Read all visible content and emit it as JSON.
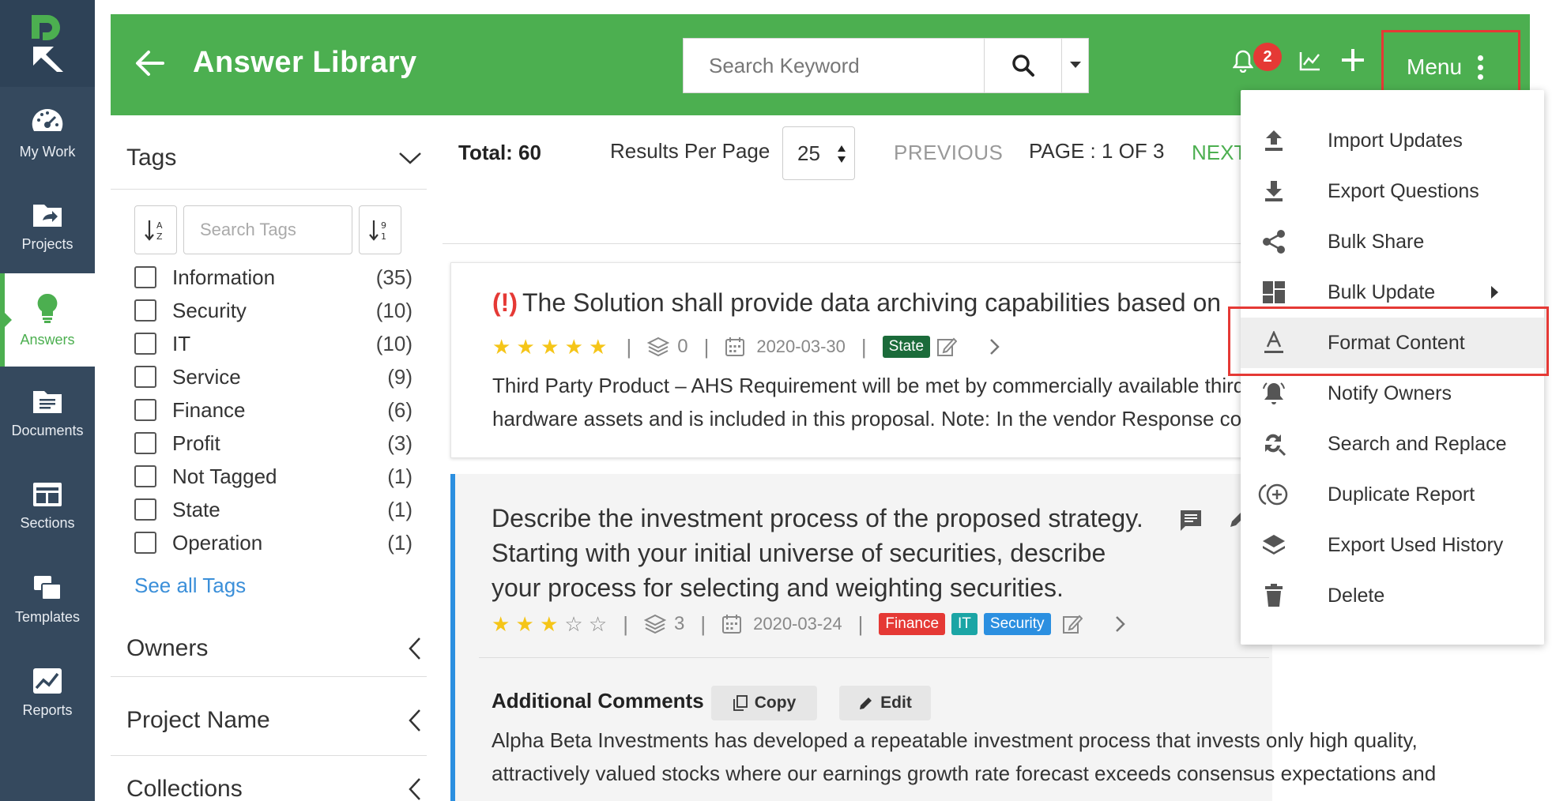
{
  "app": {
    "title": "Answer Library"
  },
  "nav": {
    "items": [
      {
        "label": "My Work",
        "icon": "speedometer-icon"
      },
      {
        "label": "Projects",
        "icon": "folder-share-icon"
      },
      {
        "label": "Answers",
        "icon": "lightbulb-icon",
        "active": true
      },
      {
        "label": "Documents",
        "icon": "document-icon"
      },
      {
        "label": "Sections",
        "icon": "sections-icon"
      },
      {
        "label": "Templates",
        "icon": "templates-icon"
      },
      {
        "label": "Reports",
        "icon": "reports-icon"
      }
    ]
  },
  "header": {
    "search_placeholder": "Search Keyword",
    "notifications_count": "2",
    "menu_label": "Menu"
  },
  "tags": {
    "heading": "Tags",
    "search_placeholder": "Search Tags",
    "items": [
      {
        "name": "Information",
        "count": "(35)"
      },
      {
        "name": "Security",
        "count": "(10)"
      },
      {
        "name": "IT",
        "count": "(10)"
      },
      {
        "name": "Service",
        "count": "(9)"
      },
      {
        "name": "Finance",
        "count": "(6)"
      },
      {
        "name": "Profit",
        "count": "(3)"
      },
      {
        "name": "Not Tagged",
        "count": "(1)"
      },
      {
        "name": "State",
        "count": "(1)"
      },
      {
        "name": "Operation",
        "count": "(1)"
      }
    ],
    "see_all": "See all Tags"
  },
  "filters": {
    "owners": "Owners",
    "project_name": "Project Name",
    "collections": "Collections"
  },
  "toolbar": {
    "total": "Total: 60",
    "results_per_page_label": "Results Per Page",
    "results_per_page_value": "25",
    "previous": "PREVIOUS",
    "page": "PAGE : 1 OF 3",
    "next": "NEXT"
  },
  "cards": [
    {
      "warning": "(!)",
      "title": "The Solution shall provide data archiving capabilities based on",
      "rating": 5,
      "stars_filled": "★ ★ ★ ★ ★",
      "stars_empty": "",
      "count": "0",
      "date": "2020-03-30",
      "tags": [
        "State"
      ],
      "answer_lines": [
        "Third Party Product – AHS Requirement will be met by commercially available third",
        "hardware assets and is included in this proposal.  Note: In the vendor Response co"
      ]
    },
    {
      "title_lines": [
        "Describe the investment process of the proposed strategy.",
        "Starting with your initial universe of securities, describe",
        "your process for selecting and weighting securities."
      ],
      "rating": 3,
      "stars_filled": "★ ★ ★",
      "stars_empty": "☆ ☆",
      "count": "3",
      "date": "2020-03-24",
      "tags": [
        "Finance",
        "IT",
        "Security"
      ],
      "comments_title": "Additional Comments",
      "copy_label": "Copy",
      "edit_label": "Edit",
      "comment_lines": [
        "Alpha Beta Investments has developed a repeatable investment process that invests only high quality,",
        "attractively valued stocks where our earnings growth rate forecast exceeds consensus expectations and"
      ]
    }
  ],
  "menu": {
    "items": [
      {
        "label": "Import Updates",
        "icon": "upload-icon"
      },
      {
        "label": "Export Questions",
        "icon": "download-icon"
      },
      {
        "label": "Bulk Share",
        "icon": "share-icon"
      },
      {
        "label": "Bulk Update",
        "icon": "dashboard-icon",
        "submenu": true
      },
      {
        "label": "Format Content",
        "icon": "format-text-icon",
        "highlighted": true
      },
      {
        "label": "Notify Owners",
        "icon": "bell-ring-icon"
      },
      {
        "label": "Search and Replace",
        "icon": "find-replace-icon"
      },
      {
        "label": "Duplicate Report",
        "icon": "duplicate-icon"
      },
      {
        "label": "Export Used History",
        "icon": "layers-icon"
      },
      {
        "label": "Delete",
        "icon": "trash-icon"
      }
    ]
  },
  "colors": {
    "brand_green": "#4caf50",
    "nav_bg": "#35495e",
    "highlight_red": "#e53935",
    "link_blue": "#3b8fd9"
  }
}
